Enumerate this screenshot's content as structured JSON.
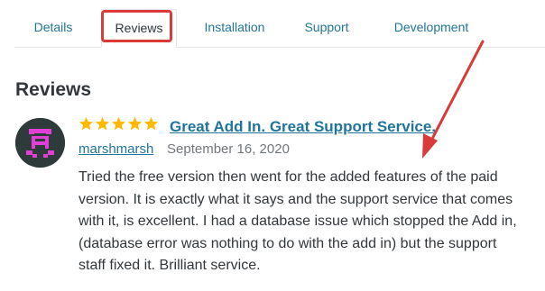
{
  "tabs": [
    {
      "label": "Details"
    },
    {
      "label": "Reviews"
    },
    {
      "label": "Installation"
    },
    {
      "label": "Support"
    },
    {
      "label": "Development"
    }
  ],
  "active_tab": "Reviews",
  "section": {
    "heading": "Reviews"
  },
  "review": {
    "rating": 5,
    "rating_max": 5,
    "title": "Great Add In. Great Support Service.",
    "author": "marshmarsh",
    "date": "September 16, 2020",
    "body": "Tried the free version then went for the added features of the paid version. It is exactly what it says and the support service that comes with it, is excellent. I had a database issue which stopped the Add in, (database error was nothing to do with the add in) but the support staff fixed it. Brilliant service."
  },
  "colors": {
    "link": "#21759b",
    "star": "#ffb900",
    "annotation": "#d93a3a",
    "avatar_bg": "#2f3a3a",
    "avatar_fg": "#e23fd6"
  },
  "icons": {
    "star": "star-icon",
    "avatar": "identicon-avatar",
    "annotation_arrow": "red-arrow"
  }
}
